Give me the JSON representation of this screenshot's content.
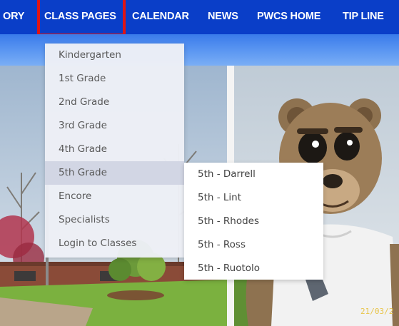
{
  "nav": {
    "items": [
      {
        "label": "ORY",
        "name": "nav-item-directory"
      },
      {
        "label": "CLASS PAGES",
        "name": "nav-item-class-pages"
      },
      {
        "label": "CALENDAR",
        "name": "nav-item-calendar"
      },
      {
        "label": "NEWS",
        "name": "nav-item-news"
      },
      {
        "label": "PWCS HOME",
        "name": "nav-item-pwcs-home"
      },
      {
        "label": "TIP LINE",
        "name": "nav-item-tip-line"
      }
    ]
  },
  "dropdown": {
    "items": [
      {
        "label": "Kindergarten"
      },
      {
        "label": "1st Grade"
      },
      {
        "label": "2nd Grade"
      },
      {
        "label": "3rd Grade"
      },
      {
        "label": "4th Grade"
      },
      {
        "label": "5th Grade"
      },
      {
        "label": "Encore"
      },
      {
        "label": "Specialists"
      },
      {
        "label": "Login to Classes"
      }
    ]
  },
  "submenu": {
    "items": [
      {
        "label": "5th - Darrell"
      },
      {
        "label": "5th - Lint"
      },
      {
        "label": "5th - Rhodes"
      },
      {
        "label": "5th - Ross"
      },
      {
        "label": "5th - Ruotolo"
      }
    ]
  },
  "photo": {
    "timestamp": "21/03/2"
  },
  "colors": {
    "nav_bg": "#0a3ec8",
    "highlight": "#e01414",
    "dropdown_bg": "#edeff6",
    "dropdown_active": "#d2d6e4"
  }
}
